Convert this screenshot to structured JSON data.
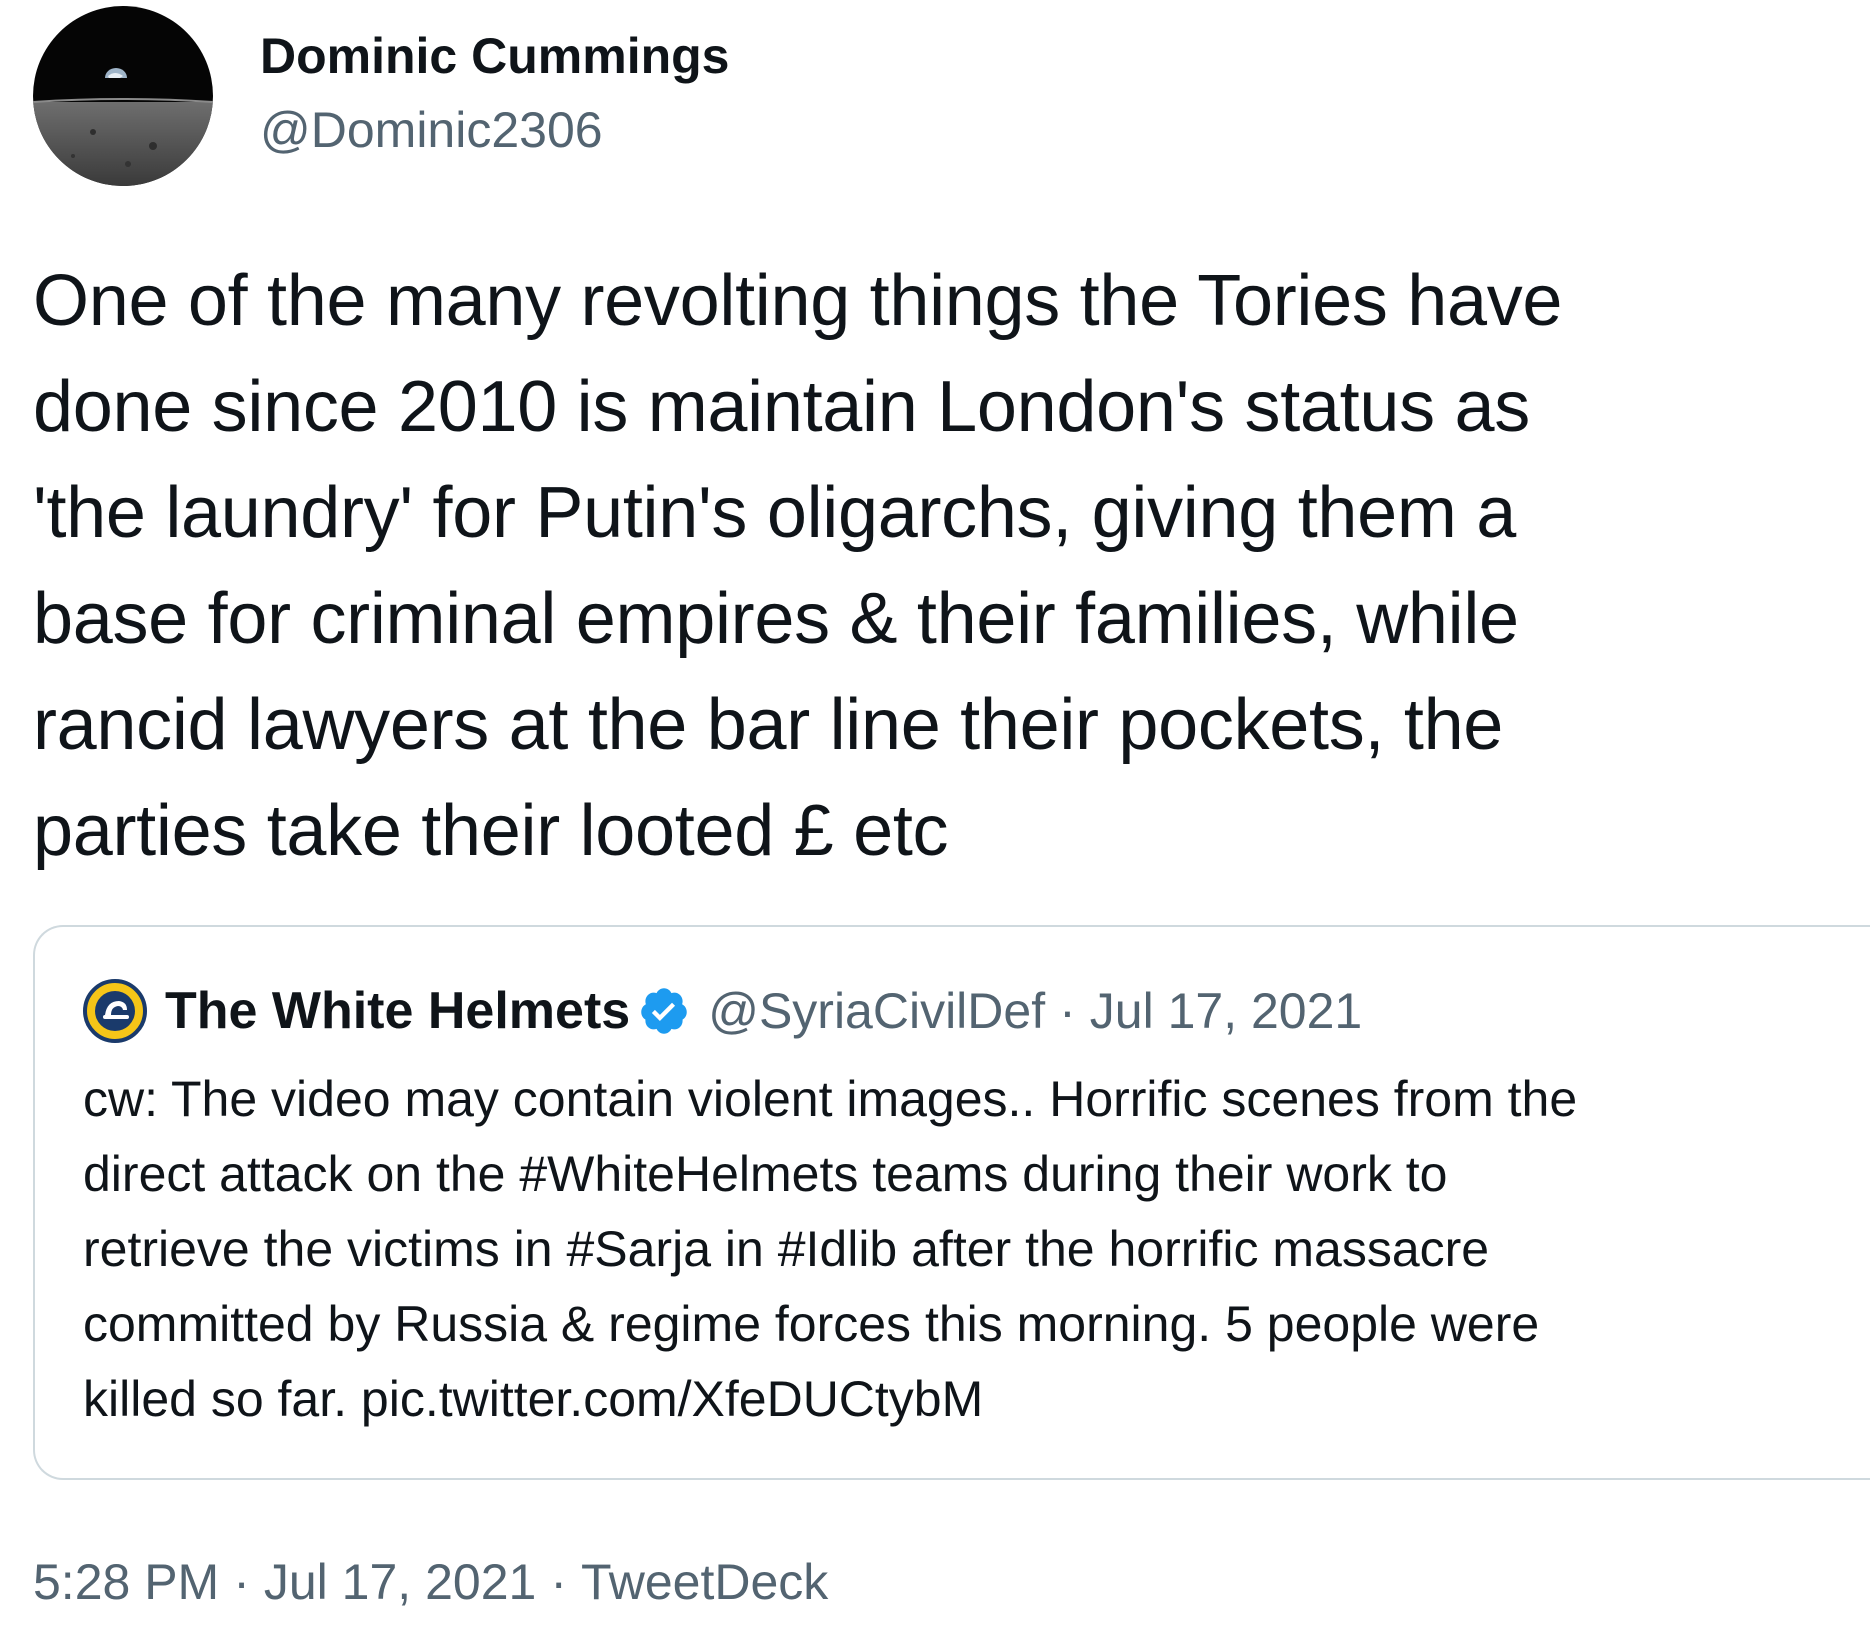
{
  "author": {
    "name": "Dominic Cummings",
    "handle": "@Dominic2306"
  },
  "tweet": {
    "text_lines": [
      "One of the many revolting things the Tories have",
      "done since 2010 is maintain London's status as",
      "'the laundry' for Putin's oligarchs, giving them a",
      "base for criminal empires & their families, while",
      "rancid lawyers at the bar line their pockets, the",
      "parties take their looted £ etc"
    ]
  },
  "quoted_tweet": {
    "name": "The White Helmets",
    "handle": "@SyriaCivilDef",
    "separator": "·",
    "date": "Jul 17, 2021",
    "verified": true,
    "text_lines": [
      "cw: The video may contain violent images.. Horrific scenes from the",
      "direct attack on the #WhiteHelmets teams during their work to",
      "retrieve the victims in #Sarja in #Idlib after the horrific massacre",
      "committed by Russia & regime forces this morning. 5 people were",
      "killed so far. pic.twitter.com/XfeDUCtybM"
    ]
  },
  "meta": {
    "time": "5:28 PM",
    "separator": "·",
    "date": "Jul 17, 2021",
    "source": "TweetDeck"
  },
  "colors": {
    "text": "#0f1419",
    "secondary": "#536471",
    "verified_blue": "#1d9bf0",
    "border": "#cfd9de"
  },
  "icons": {
    "author_avatar": "earthrise-avatar-icon",
    "quote_avatar": "white-helmets-logo-icon",
    "verified": "verified-badge-icon"
  }
}
